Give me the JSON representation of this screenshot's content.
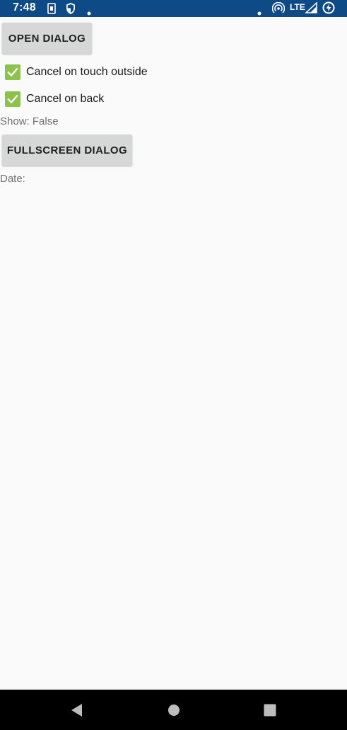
{
  "status_bar": {
    "time": "7:48",
    "network": "LTE",
    "background_color": "#0d4a86",
    "icons": [
      "sim-icon",
      "shield-icon",
      "notification-dot-icon",
      "dot-icon",
      "hotspot-icon",
      "signal-icon",
      "battery-charging-icon"
    ]
  },
  "main": {
    "open_dialog_label": "OPEN DIALOG",
    "cancel_touch_outside": {
      "label": "Cancel on touch outside",
      "checked": true
    },
    "cancel_on_back": {
      "label": "Cancel on back",
      "checked": true
    },
    "show_text": "Show: False",
    "fullscreen_dialog_label": "FULLSCREEN DIALOG",
    "date_text": "Date:",
    "checkbox_color": "#8bc34a"
  },
  "nav_bar": {
    "icons": [
      "back-icon",
      "home-icon",
      "recents-icon"
    ]
  }
}
